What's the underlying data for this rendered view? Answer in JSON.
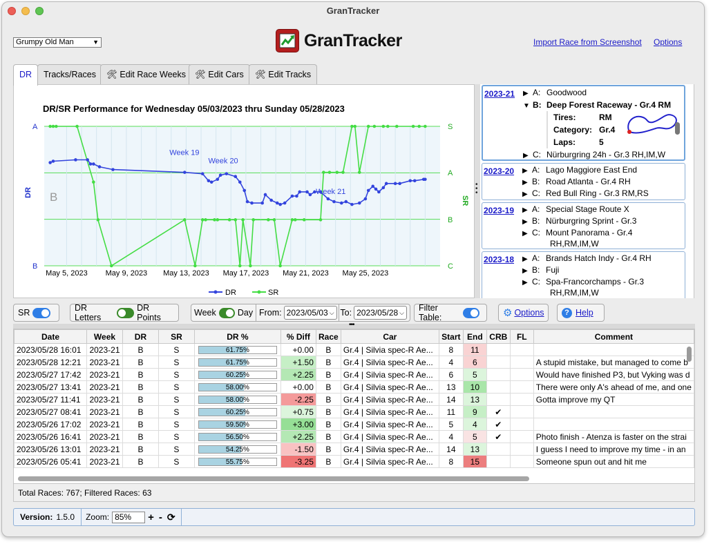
{
  "window": {
    "title": "GranTracker"
  },
  "header": {
    "driver_select": "Grumpy Old Man",
    "logo_text": "GranTracker",
    "import_link": "Import Race from Screenshot",
    "options_link": "Options"
  },
  "tabs": [
    {
      "label": "DR"
    },
    {
      "label": "Tracks/Races"
    },
    {
      "label": "Edit Race Weeks",
      "icon": "tools-icon"
    },
    {
      "label": "Edit Cars",
      "icon": "tools-icon"
    },
    {
      "label": "Edit Tracks",
      "icon": "tools-icon"
    }
  ],
  "chart_data": {
    "type": "line",
    "title": "DR/SR Performance for Wednesday 05/03/2023 thru Sunday 05/28/2023",
    "xlabel": "",
    "ylabel_left": "DR",
    "ylabel_right": "SR",
    "x_ticks": [
      "May 5, 2023",
      "May 9, 2023",
      "May 13, 2023",
      "May 17, 2023",
      "May 21, 2023",
      "May 25, 2023"
    ],
    "y_left_ticks": [
      "A",
      "B"
    ],
    "y_right_ticks": [
      "S",
      "A",
      "B",
      "C"
    ],
    "band_label": "B",
    "legend_position": "bottom",
    "annotations": [
      {
        "text": "Week 19",
        "day": 12.9,
        "dr": 0.77
      },
      {
        "text": "Week 20",
        "day": 15.5,
        "dr": 0.71
      },
      {
        "text": "Week 21",
        "day": 22.7,
        "dr": 0.49
      }
    ],
    "series": [
      {
        "name": "DR",
        "color": "#3344dd",
        "points": [
          [
            3.9,
            0.74
          ],
          [
            4.1,
            0.75
          ],
          [
            5.6,
            0.76
          ],
          [
            6.4,
            0.76
          ],
          [
            6.6,
            0.73
          ],
          [
            6.8,
            0.73
          ],
          [
            7.2,
            0.71
          ],
          [
            8.1,
            0.69
          ],
          [
            12.9,
            0.67
          ],
          [
            14.1,
            0.66
          ],
          [
            14.5,
            0.61
          ],
          [
            14.7,
            0.6
          ],
          [
            15.1,
            0.62
          ],
          [
            15.3,
            0.65
          ],
          [
            15.7,
            0.66
          ],
          [
            16.3,
            0.64
          ],
          [
            16.6,
            0.6
          ],
          [
            16.9,
            0.54
          ],
          [
            17.1,
            0.46
          ],
          [
            17.4,
            0.45
          ],
          [
            18.1,
            0.45
          ],
          [
            18.3,
            0.51
          ],
          [
            18.7,
            0.47
          ],
          [
            19.1,
            0.45
          ],
          [
            19.3,
            0.44
          ],
          [
            19.6,
            0.45
          ],
          [
            20.1,
            0.5
          ],
          [
            20.4,
            0.5
          ],
          [
            20.6,
            0.53
          ],
          [
            21.1,
            0.53
          ],
          [
            21.3,
            0.51
          ],
          [
            21.6,
            0.53
          ],
          [
            22.0,
            0.53
          ],
          [
            22.5,
            0.48
          ],
          [
            22.9,
            0.46
          ],
          [
            23.4,
            0.45
          ],
          [
            23.7,
            0.46
          ],
          [
            24.1,
            0.44
          ],
          [
            24.6,
            0.45
          ],
          [
            25.0,
            0.48
          ],
          [
            25.2,
            0.54
          ],
          [
            25.5,
            0.57
          ],
          [
            25.7,
            0.55
          ],
          [
            25.9,
            0.53
          ],
          [
            26.2,
            0.56
          ],
          [
            26.4,
            0.59
          ],
          [
            27.0,
            0.59
          ],
          [
            27.3,
            0.59
          ],
          [
            28.0,
            0.61
          ],
          [
            28.3,
            0.61
          ],
          [
            28.9,
            0.62
          ],
          [
            29.0,
            0.62
          ]
        ]
      },
      {
        "name": "SR",
        "color": "#44dd44",
        "points": [
          [
            3.9,
            1.0
          ],
          [
            4.1,
            1.0
          ],
          [
            4.3,
            1.0
          ],
          [
            5.7,
            1.0
          ],
          [
            6.8,
            0.6
          ],
          [
            7.1,
            0.33
          ],
          [
            8.0,
            0.0
          ],
          [
            12.9,
            0.33
          ],
          [
            13.6,
            0.0
          ],
          [
            14.1,
            0.33
          ],
          [
            14.3,
            0.33
          ],
          [
            14.9,
            0.33
          ],
          [
            15.1,
            0.33
          ],
          [
            15.9,
            0.33
          ],
          [
            16.3,
            0.33
          ],
          [
            16.6,
            0.0
          ],
          [
            16.8,
            0.33
          ],
          [
            17.3,
            0.0
          ],
          [
            17.5,
            0.33
          ],
          [
            18.5,
            0.33
          ],
          [
            18.9,
            0.33
          ],
          [
            19.3,
            0.0
          ],
          [
            20.1,
            0.33
          ],
          [
            20.3,
            0.33
          ],
          [
            20.9,
            0.33
          ],
          [
            22.0,
            0.33
          ],
          [
            22.2,
            0.67
          ],
          [
            22.6,
            0.67
          ],
          [
            23.1,
            0.67
          ],
          [
            23.5,
            0.67
          ],
          [
            24.1,
            1.0
          ],
          [
            24.3,
            1.0
          ],
          [
            24.6,
            0.67
          ],
          [
            25.2,
            1.0
          ],
          [
            25.6,
            1.0
          ],
          [
            26.2,
            1.0
          ],
          [
            26.5,
            1.0
          ],
          [
            27.1,
            1.0
          ],
          [
            28.2,
            1.0
          ],
          [
            28.6,
            1.0
          ],
          [
            29.0,
            1.0
          ]
        ]
      }
    ]
  },
  "weeks": [
    {
      "id": "2023-21",
      "races": [
        {
          "letter": "A:",
          "name": "Goodwood",
          "open": false
        },
        {
          "letter": "B:",
          "name": "Deep Forest Raceway - Gr.4 RM",
          "open": true,
          "details": {
            "tires_label": "Tires:",
            "tires": "RM",
            "category_label": "Category:",
            "category": "Gr.4",
            "laps_label": "Laps:",
            "laps": "5"
          }
        },
        {
          "letter": "C:",
          "name": "Nürburgring 24h - Gr.3 RH,IM,W",
          "open": false
        }
      ]
    },
    {
      "id": "2023-20",
      "races": [
        {
          "letter": "A:",
          "name": "Lago Maggiore East End"
        },
        {
          "letter": "B:",
          "name": "Road Atlanta - Gr.4 RH"
        },
        {
          "letter": "C:",
          "name": "Red Bull Ring - Gr.3 RM,RS"
        }
      ]
    },
    {
      "id": "2023-19",
      "races": [
        {
          "letter": "A:",
          "name": "Special Stage Route X"
        },
        {
          "letter": "B:",
          "name": "Nürburgring Sprint - Gr.3"
        },
        {
          "letter": "C:",
          "name": "Mount Panorama - Gr.4",
          "cont": "RH,RM,IM,W"
        }
      ]
    },
    {
      "id": "2023-18",
      "races": [
        {
          "letter": "A:",
          "name": "Brands Hatch Indy - Gr.4 RH"
        },
        {
          "letter": "B:",
          "name": "Fuji"
        },
        {
          "letter": "C:",
          "name": "Spa-Francorchamps - Gr.3",
          "cont": "RH,RM,IM,W"
        }
      ]
    }
  ],
  "controls": {
    "sr_label": "SR",
    "dr_letters": "DR Letters",
    "dr_points": "DR Points",
    "week": "Week",
    "day": "Day",
    "from_label": "From:",
    "from_value": "2023/05/03",
    "to_label": "To:",
    "to_value": "2023/05/28",
    "filter_table": "Filter Table:",
    "options": "Options",
    "help": "Help"
  },
  "table": {
    "columns": [
      "Date",
      "Week",
      "DR",
      "SR",
      "DR %",
      "% Diff",
      "Race",
      "Car",
      "Start",
      "End",
      "CRB",
      "FL",
      "Comment"
    ],
    "rows": [
      {
        "date": "2023/05/28 16:01",
        "week": "2023-21",
        "dr": "B",
        "sr": "S",
        "drp": "61.75%",
        "drp_val": 61.75,
        "diff": "+0.00",
        "diff_bg": "#ffffff",
        "race": "B",
        "car": "Gr.4 | Silvia spec-R Ae...",
        "start": "8",
        "end": "11",
        "end_bg": "#f9d3d3",
        "crb": "",
        "fl": "",
        "comment": ""
      },
      {
        "date": "2023/05/28 12:21",
        "week": "2023-21",
        "dr": "B",
        "sr": "S",
        "drp": "61.75%",
        "drp_val": 61.75,
        "diff": "+1.50",
        "diff_bg": "#c6efc6",
        "race": "B",
        "car": "Gr.4 | Silvia spec-R Ae...",
        "start": "4",
        "end": "6",
        "end_bg": "#f9d3d3",
        "crb": "",
        "fl": "",
        "comment": "A stupid mistake, but managed to come b"
      },
      {
        "date": "2023/05/27 17:42",
        "week": "2023-21",
        "dr": "B",
        "sr": "S",
        "drp": "60.25%",
        "drp_val": 60.25,
        "diff": "+2.25",
        "diff_bg": "#b4e8b4",
        "race": "B",
        "car": "Gr.4 | Silvia spec-R Ae...",
        "start": "6",
        "end": "5",
        "end_bg": "#dcf5dc",
        "crb": "",
        "fl": "",
        "comment": "Would have finished P3, but Vyking was d"
      },
      {
        "date": "2023/05/27 13:41",
        "week": "2023-21",
        "dr": "B",
        "sr": "S",
        "drp": "58.00%",
        "drp_val": 58.0,
        "diff": "+0.00",
        "diff_bg": "#ffffff",
        "race": "B",
        "car": "Gr.4 | Silvia spec-R Ae...",
        "start": "13",
        "end": "10",
        "end_bg": "#a9e6a9",
        "crb": "",
        "fl": "",
        "comment": "There were only A's ahead of me, and one"
      },
      {
        "date": "2023/05/27 11:41",
        "week": "2023-21",
        "dr": "B",
        "sr": "S",
        "drp": "58.00%",
        "drp_val": 58.0,
        "diff": "-2.25",
        "diff_bg": "#f49a9a",
        "race": "B",
        "car": "Gr.4 | Silvia spec-R Ae...",
        "start": "14",
        "end": "13",
        "end_bg": "#dcf5dc",
        "crb": "",
        "fl": "",
        "comment": "Gotta improve my QT"
      },
      {
        "date": "2023/05/27 08:41",
        "week": "2023-21",
        "dr": "B",
        "sr": "S",
        "drp": "60.25%",
        "drp_val": 60.25,
        "diff": "+0.75",
        "diff_bg": "#dcf5dc",
        "race": "B",
        "car": "Gr.4 | Silvia spec-R Ae...",
        "start": "11",
        "end": "9",
        "end_bg": "#c6efc6",
        "crb": "✔",
        "fl": "",
        "comment": ""
      },
      {
        "date": "2023/05/26 17:02",
        "week": "2023-21",
        "dr": "B",
        "sr": "S",
        "drp": "59.50%",
        "drp_val": 59.5,
        "diff": "+3.00",
        "diff_bg": "#96df96",
        "race": "B",
        "car": "Gr.4 | Silvia spec-R Ae...",
        "start": "5",
        "end": "4",
        "end_bg": "#dcf5dc",
        "crb": "✔",
        "fl": "",
        "comment": ""
      },
      {
        "date": "2023/05/26 16:41",
        "week": "2023-21",
        "dr": "B",
        "sr": "S",
        "drp": "56.50%",
        "drp_val": 56.5,
        "diff": "+2.25",
        "diff_bg": "#b4e8b4",
        "race": "B",
        "car": "Gr.4 | Silvia spec-R Ae...",
        "start": "4",
        "end": "5",
        "end_bg": "#f9e3e3",
        "crb": "✔",
        "fl": "",
        "comment": "Photo finish - Atenza is faster on the strai"
      },
      {
        "date": "2023/05/26 13:01",
        "week": "2023-21",
        "dr": "B",
        "sr": "S",
        "drp": "54.25%",
        "drp_val": 54.25,
        "diff": "-1.50",
        "diff_bg": "#f9c2c2",
        "race": "B",
        "car": "Gr.4 | Silvia spec-R Ae...",
        "start": "14",
        "end": "13",
        "end_bg": "#dcf5dc",
        "crb": "",
        "fl": "",
        "comment": "I guess I need to improve my time - in an"
      },
      {
        "date": "2023/05/26 05:41",
        "week": "2023-21",
        "dr": "B",
        "sr": "S",
        "drp": "55.75%",
        "drp_val": 55.75,
        "diff": "-3.25",
        "diff_bg": "#ef7474",
        "race": "B",
        "car": "Gr.4 | Silvia spec-R Ae...",
        "start": "8",
        "end": "15",
        "end_bg": "#ec7e7e",
        "crb": "",
        "fl": "",
        "comment": "Someone spun out and hit me"
      }
    ],
    "totals": "Total Races: 767; Filtered Races: 63"
  },
  "status": {
    "version_label": "Version:",
    "version": "1.5.0",
    "zoom_label": "Zoom:",
    "zoom": "85%",
    "plus": "+",
    "minus": "-"
  }
}
